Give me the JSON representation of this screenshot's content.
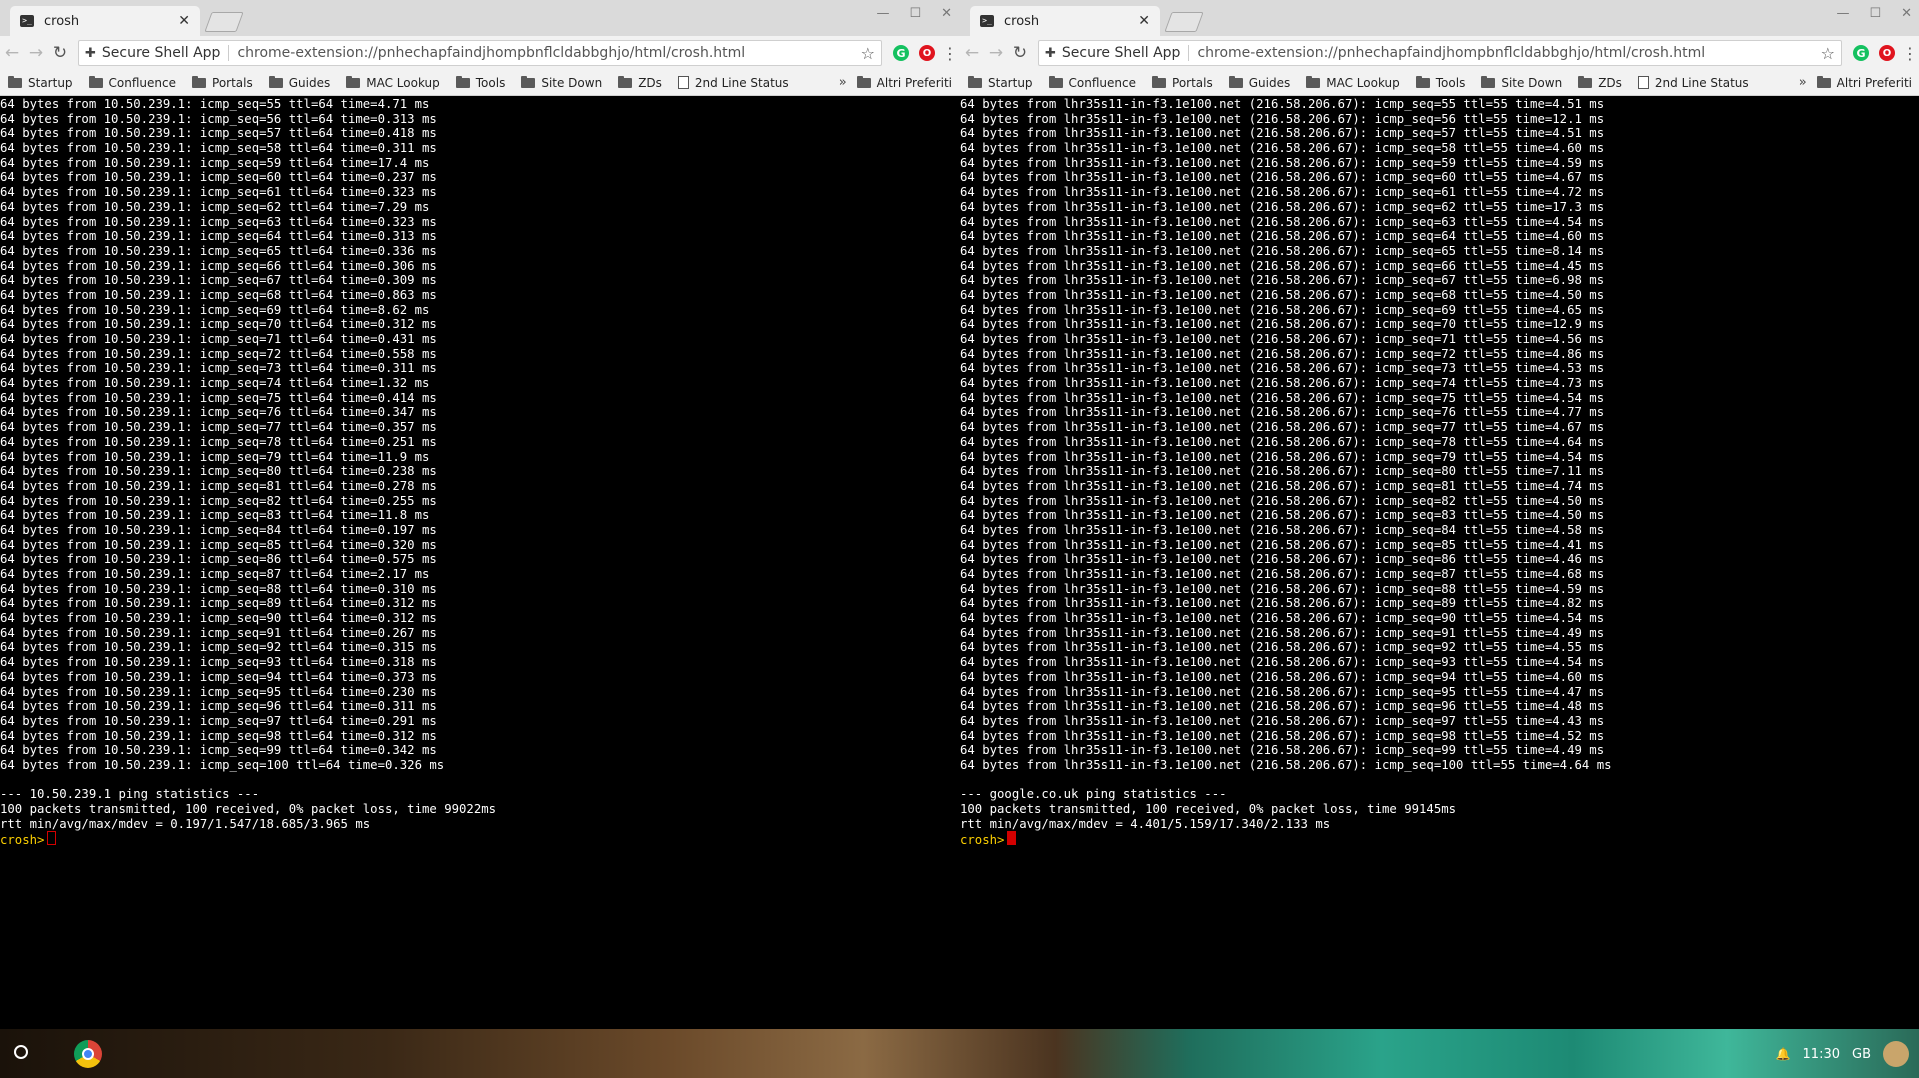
{
  "left": {
    "tab_title": "crosh",
    "omnibox_app": "Secure Shell App",
    "omnibox_url": "chrome-extension://pnhechapfaindjhompbnflcldabbghjo/html/crosh.html",
    "terminal_lines": [
      "64 bytes from 10.50.239.1: icmp_seq=55 ttl=64 time=4.71 ms",
      "64 bytes from 10.50.239.1: icmp_seq=56 ttl=64 time=0.313 ms",
      "64 bytes from 10.50.239.1: icmp_seq=57 ttl=64 time=0.418 ms",
      "64 bytes from 10.50.239.1: icmp_seq=58 ttl=64 time=0.311 ms",
      "64 bytes from 10.50.239.1: icmp_seq=59 ttl=64 time=17.4 ms",
      "64 bytes from 10.50.239.1: icmp_seq=60 ttl=64 time=0.237 ms",
      "64 bytes from 10.50.239.1: icmp_seq=61 ttl=64 time=0.323 ms",
      "64 bytes from 10.50.239.1: icmp_seq=62 ttl=64 time=7.29 ms",
      "64 bytes from 10.50.239.1: icmp_seq=63 ttl=64 time=0.323 ms",
      "64 bytes from 10.50.239.1: icmp_seq=64 ttl=64 time=0.313 ms",
      "64 bytes from 10.50.239.1: icmp_seq=65 ttl=64 time=0.336 ms",
      "64 bytes from 10.50.239.1: icmp_seq=66 ttl=64 time=0.306 ms",
      "64 bytes from 10.50.239.1: icmp_seq=67 ttl=64 time=0.309 ms",
      "64 bytes from 10.50.239.1: icmp_seq=68 ttl=64 time=0.863 ms",
      "64 bytes from 10.50.239.1: icmp_seq=69 ttl=64 time=8.62 ms",
      "64 bytes from 10.50.239.1: icmp_seq=70 ttl=64 time=0.312 ms",
      "64 bytes from 10.50.239.1: icmp_seq=71 ttl=64 time=0.431 ms",
      "64 bytes from 10.50.239.1: icmp_seq=72 ttl=64 time=0.558 ms",
      "64 bytes from 10.50.239.1: icmp_seq=73 ttl=64 time=0.311 ms",
      "64 bytes from 10.50.239.1: icmp_seq=74 ttl=64 time=1.32 ms",
      "64 bytes from 10.50.239.1: icmp_seq=75 ttl=64 time=0.414 ms",
      "64 bytes from 10.50.239.1: icmp_seq=76 ttl=64 time=0.347 ms",
      "64 bytes from 10.50.239.1: icmp_seq=77 ttl=64 time=0.357 ms",
      "64 bytes from 10.50.239.1: icmp_seq=78 ttl=64 time=0.251 ms",
      "64 bytes from 10.50.239.1: icmp_seq=79 ttl=64 time=11.9 ms",
      "64 bytes from 10.50.239.1: icmp_seq=80 ttl=64 time=0.238 ms",
      "64 bytes from 10.50.239.1: icmp_seq=81 ttl=64 time=0.278 ms",
      "64 bytes from 10.50.239.1: icmp_seq=82 ttl=64 time=0.255 ms",
      "64 bytes from 10.50.239.1: icmp_seq=83 ttl=64 time=11.8 ms",
      "64 bytes from 10.50.239.1: icmp_seq=84 ttl=64 time=0.197 ms",
      "64 bytes from 10.50.239.1: icmp_seq=85 ttl=64 time=0.320 ms",
      "64 bytes from 10.50.239.1: icmp_seq=86 ttl=64 time=0.575 ms",
      "64 bytes from 10.50.239.1: icmp_seq=87 ttl=64 time=2.17 ms",
      "64 bytes from 10.50.239.1: icmp_seq=88 ttl=64 time=0.310 ms",
      "64 bytes from 10.50.239.1: icmp_seq=89 ttl=64 time=0.312 ms",
      "64 bytes from 10.50.239.1: icmp_seq=90 ttl=64 time=0.312 ms",
      "64 bytes from 10.50.239.1: icmp_seq=91 ttl=64 time=0.267 ms",
      "64 bytes from 10.50.239.1: icmp_seq=92 ttl=64 time=0.315 ms",
      "64 bytes from 10.50.239.1: icmp_seq=93 ttl=64 time=0.318 ms",
      "64 bytes from 10.50.239.1: icmp_seq=94 ttl=64 time=0.373 ms",
      "64 bytes from 10.50.239.1: icmp_seq=95 ttl=64 time=0.230 ms",
      "64 bytes from 10.50.239.1: icmp_seq=96 ttl=64 time=0.311 ms",
      "64 bytes from 10.50.239.1: icmp_seq=97 ttl=64 time=0.291 ms",
      "64 bytes from 10.50.239.1: icmp_seq=98 ttl=64 time=0.312 ms",
      "64 bytes from 10.50.239.1: icmp_seq=99 ttl=64 time=0.342 ms",
      "64 bytes from 10.50.239.1: icmp_seq=100 ttl=64 time=0.326 ms",
      "",
      "--- 10.50.239.1 ping statistics ---",
      "100 packets transmitted, 100 received, 0% packet loss, time 99022ms",
      "rtt min/avg/max/mdev = 0.197/1.547/18.685/3.965 ms"
    ],
    "prompt": "crosh>"
  },
  "right": {
    "tab_title": "crosh",
    "omnibox_app": "Secure Shell App",
    "omnibox_url": "chrome-extension://pnhechapfaindjhompbnflcldabbghjo/html/crosh.html",
    "terminal_lines": [
      "64 bytes from lhr35s11-in-f3.1e100.net (216.58.206.67): icmp_seq=55 ttl=55 time=4.51 ms",
      "64 bytes from lhr35s11-in-f3.1e100.net (216.58.206.67): icmp_seq=56 ttl=55 time=12.1 ms",
      "64 bytes from lhr35s11-in-f3.1e100.net (216.58.206.67): icmp_seq=57 ttl=55 time=4.51 ms",
      "64 bytes from lhr35s11-in-f3.1e100.net (216.58.206.67): icmp_seq=58 ttl=55 time=4.60 ms",
      "64 bytes from lhr35s11-in-f3.1e100.net (216.58.206.67): icmp_seq=59 ttl=55 time=4.59 ms",
      "64 bytes from lhr35s11-in-f3.1e100.net (216.58.206.67): icmp_seq=60 ttl=55 time=4.67 ms",
      "64 bytes from lhr35s11-in-f3.1e100.net (216.58.206.67): icmp_seq=61 ttl=55 time=4.72 ms",
      "64 bytes from lhr35s11-in-f3.1e100.net (216.58.206.67): icmp_seq=62 ttl=55 time=17.3 ms",
      "64 bytes from lhr35s11-in-f3.1e100.net (216.58.206.67): icmp_seq=63 ttl=55 time=4.54 ms",
      "64 bytes from lhr35s11-in-f3.1e100.net (216.58.206.67): icmp_seq=64 ttl=55 time=4.60 ms",
      "64 bytes from lhr35s11-in-f3.1e100.net (216.58.206.67): icmp_seq=65 ttl=55 time=8.14 ms",
      "64 bytes from lhr35s11-in-f3.1e100.net (216.58.206.67): icmp_seq=66 ttl=55 time=4.45 ms",
      "64 bytes from lhr35s11-in-f3.1e100.net (216.58.206.67): icmp_seq=67 ttl=55 time=6.98 ms",
      "64 bytes from lhr35s11-in-f3.1e100.net (216.58.206.67): icmp_seq=68 ttl=55 time=4.50 ms",
      "64 bytes from lhr35s11-in-f3.1e100.net (216.58.206.67): icmp_seq=69 ttl=55 time=4.65 ms",
      "64 bytes from lhr35s11-in-f3.1e100.net (216.58.206.67): icmp_seq=70 ttl=55 time=12.9 ms",
      "64 bytes from lhr35s11-in-f3.1e100.net (216.58.206.67): icmp_seq=71 ttl=55 time=4.56 ms",
      "64 bytes from lhr35s11-in-f3.1e100.net (216.58.206.67): icmp_seq=72 ttl=55 time=4.86 ms",
      "64 bytes from lhr35s11-in-f3.1e100.net (216.58.206.67): icmp_seq=73 ttl=55 time=4.53 ms",
      "64 bytes from lhr35s11-in-f3.1e100.net (216.58.206.67): icmp_seq=74 ttl=55 time=4.73 ms",
      "64 bytes from lhr35s11-in-f3.1e100.net (216.58.206.67): icmp_seq=75 ttl=55 time=4.54 ms",
      "64 bytes from lhr35s11-in-f3.1e100.net (216.58.206.67): icmp_seq=76 ttl=55 time=4.77 ms",
      "64 bytes from lhr35s11-in-f3.1e100.net (216.58.206.67): icmp_seq=77 ttl=55 time=4.67 ms",
      "64 bytes from lhr35s11-in-f3.1e100.net (216.58.206.67): icmp_seq=78 ttl=55 time=4.64 ms",
      "64 bytes from lhr35s11-in-f3.1e100.net (216.58.206.67): icmp_seq=79 ttl=55 time=4.54 ms",
      "64 bytes from lhr35s11-in-f3.1e100.net (216.58.206.67): icmp_seq=80 ttl=55 time=7.11 ms",
      "64 bytes from lhr35s11-in-f3.1e100.net (216.58.206.67): icmp_seq=81 ttl=55 time=4.74 ms",
      "64 bytes from lhr35s11-in-f3.1e100.net (216.58.206.67): icmp_seq=82 ttl=55 time=4.50 ms",
      "64 bytes from lhr35s11-in-f3.1e100.net (216.58.206.67): icmp_seq=83 ttl=55 time=4.50 ms",
      "64 bytes from lhr35s11-in-f3.1e100.net (216.58.206.67): icmp_seq=84 ttl=55 time=4.58 ms",
      "64 bytes from lhr35s11-in-f3.1e100.net (216.58.206.67): icmp_seq=85 ttl=55 time=4.41 ms",
      "64 bytes from lhr35s11-in-f3.1e100.net (216.58.206.67): icmp_seq=86 ttl=55 time=4.46 ms",
      "64 bytes from lhr35s11-in-f3.1e100.net (216.58.206.67): icmp_seq=87 ttl=55 time=4.68 ms",
      "64 bytes from lhr35s11-in-f3.1e100.net (216.58.206.67): icmp_seq=88 ttl=55 time=4.59 ms",
      "64 bytes from lhr35s11-in-f3.1e100.net (216.58.206.67): icmp_seq=89 ttl=55 time=4.82 ms",
      "64 bytes from lhr35s11-in-f3.1e100.net (216.58.206.67): icmp_seq=90 ttl=55 time=4.54 ms",
      "64 bytes from lhr35s11-in-f3.1e100.net (216.58.206.67): icmp_seq=91 ttl=55 time=4.49 ms",
      "64 bytes from lhr35s11-in-f3.1e100.net (216.58.206.67): icmp_seq=92 ttl=55 time=4.55 ms",
      "64 bytes from lhr35s11-in-f3.1e100.net (216.58.206.67): icmp_seq=93 ttl=55 time=4.54 ms",
      "64 bytes from lhr35s11-in-f3.1e100.net (216.58.206.67): icmp_seq=94 ttl=55 time=4.60 ms",
      "64 bytes from lhr35s11-in-f3.1e100.net (216.58.206.67): icmp_seq=95 ttl=55 time=4.47 ms",
      "64 bytes from lhr35s11-in-f3.1e100.net (216.58.206.67): icmp_seq=96 ttl=55 time=4.48 ms",
      "64 bytes from lhr35s11-in-f3.1e100.net (216.58.206.67): icmp_seq=97 ttl=55 time=4.43 ms",
      "64 bytes from lhr35s11-in-f3.1e100.net (216.58.206.67): icmp_seq=98 ttl=55 time=4.52 ms",
      "64 bytes from lhr35s11-in-f3.1e100.net (216.58.206.67): icmp_seq=99 ttl=55 time=4.49 ms",
      "64 bytes from lhr35s11-in-f3.1e100.net (216.58.206.67): icmp_seq=100 ttl=55 time=4.64 ms",
      "",
      "--- google.co.uk ping statistics ---",
      "100 packets transmitted, 100 received, 0% packet loss, time 99145ms",
      "rtt min/avg/max/mdev = 4.401/5.159/17.340/2.133 ms"
    ],
    "prompt": "crosh>"
  },
  "bookmarks": {
    "startup": "Startup",
    "confluence": "Confluence",
    "portals": "Portals",
    "guides": "Guides",
    "mac_lookup": "MAC Lookup",
    "tools": "Tools",
    "site_down": "Site Down",
    "zds": "ZDs",
    "second_line": "2nd Line Status",
    "other": "Altri Preferiti"
  },
  "tray": {
    "time": "11:30",
    "locale": "GB"
  },
  "colors": {
    "terminal_bg": "#000000",
    "terminal_fg": "#ffffff",
    "prompt": "#fdd000",
    "cursor": "#d30000"
  }
}
